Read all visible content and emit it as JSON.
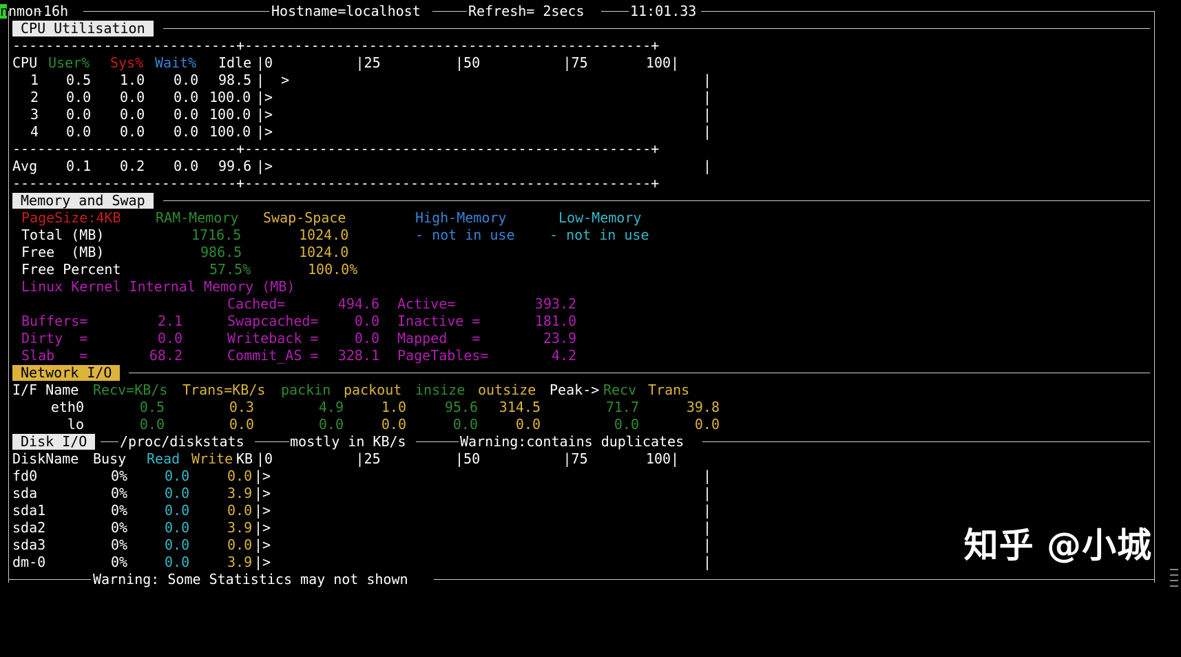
{
  "titlebar": {
    "app": "nmon",
    "version": "16h",
    "hostname": "Hostname=localhost",
    "refresh": "Refresh= 2secs",
    "time": "11:01.33",
    "cursor_char": "n"
  },
  "cpu": {
    "section_title": "CPU Utilisation",
    "separator": "---------------------------+-------------------------------------------------+",
    "columns": {
      "cpu": "CPU",
      "user": "User%",
      "sys": "Sys%",
      "wait": "Wait%",
      "idle": "Idle"
    },
    "scale": "|0          |25         |50          |75       100|",
    "rows": [
      {
        "id": "1",
        "user": "0.5",
        "sys": "1.0",
        "wait": "0.0",
        "idle": "98.5",
        "bar": "|  >"
      },
      {
        "id": "2",
        "user": "0.0",
        "sys": "0.0",
        "wait": "0.0",
        "idle": "100.0",
        "bar": "|>"
      },
      {
        "id": "3",
        "user": "0.0",
        "sys": "0.0",
        "wait": "0.0",
        "idle": "100.0",
        "bar": "|>"
      },
      {
        "id": "4",
        "user": "0.0",
        "sys": "0.0",
        "wait": "0.0",
        "idle": "100.0",
        "bar": "|>"
      }
    ],
    "avg": {
      "id": "Avg",
      "user": "0.1",
      "sys": "0.2",
      "wait": "0.0",
      "idle": "99.6",
      "bar": "|>"
    }
  },
  "memory": {
    "section_title": "Memory and Swap",
    "header": {
      "pagesize": "PageSize:4KB",
      "ram": "RAM-Memory",
      "swap": "Swap-Space",
      "high": "High-Memory",
      "low": "Low-Memory"
    },
    "total": {
      "label": "Total (MB)",
      "ram": "1716.5",
      "swap": "1024.0",
      "high": "- not in use",
      "low": "- not in use"
    },
    "free": {
      "label": "Free  (MB)",
      "ram": "986.5",
      "swap": "1024.0"
    },
    "percent": {
      "label": "Free Percent",
      "ram": "57.5%",
      "swap": "100.0%"
    },
    "kernel_title": "Linux Kernel Internal Memory (MB)",
    "kernel_rows": [
      [
        "",
        "",
        "Cached=",
        "494.6",
        "Active=",
        "393.2"
      ],
      [
        "Buffers=",
        "2.1",
        "Swapcached=",
        "0.0",
        "Inactive =",
        "181.0"
      ],
      [
        "Dirty  =",
        "0.0",
        "Writeback =",
        "0.0",
        "Mapped   =",
        "23.9"
      ],
      [
        "Slab   =",
        "68.2",
        "Commit_AS =",
        "328.1",
        "PageTables=",
        "4.2"
      ]
    ]
  },
  "network": {
    "section_title": "Network I/O",
    "columns": {
      "ifname": "I/F Name",
      "recv": "Recv=KB/s",
      "trans": "Trans=KB/s",
      "packin": "packin",
      "packout": "packout",
      "insize": "insize",
      "outsize": "outsize",
      "peak": "Peak->",
      "peak_recv": "Recv",
      "peak_trans": "Trans"
    },
    "rows": [
      {
        "name": "eth0",
        "recv": "0.5",
        "trans": "0.3",
        "packin": "4.9",
        "packout": "1.0",
        "insize": "95.6",
        "outsize": "314.5",
        "peak_recv": "71.7",
        "peak_trans": "39.8"
      },
      {
        "name": "lo",
        "recv": "0.0",
        "trans": "0.0",
        "packin": "0.0",
        "packout": "0.0",
        "insize": "0.0",
        "outsize": "0.0",
        "peak_recv": "0.0",
        "peak_trans": "0.0"
      }
    ]
  },
  "disk": {
    "section_title": "Disk I/O",
    "source": "/proc/diskstats",
    "units": "mostly in KB/s",
    "warning": "Warning:contains duplicates",
    "columns": {
      "name": "DiskName",
      "busy": "Busy",
      "read": "Read",
      "write": "Write",
      "kb": "KB"
    },
    "scale": "|0          |25         |50          |75       100|",
    "rows": [
      {
        "name": "fd0",
        "busy": "0%",
        "read": "0.0",
        "write": "0.0",
        "bar": "|>"
      },
      {
        "name": "sda",
        "busy": "0%",
        "read": "0.0",
        "write": "3.9",
        "bar": "|>"
      },
      {
        "name": "sda1",
        "busy": "0%",
        "read": "0.0",
        "write": "0.0",
        "bar": "|>"
      },
      {
        "name": "sda2",
        "busy": "0%",
        "read": "0.0",
        "write": "3.9",
        "bar": "|>"
      },
      {
        "name": "sda3",
        "busy": "0%",
        "read": "0.0",
        "write": "0.0",
        "bar": "|>"
      },
      {
        "name": "dm-0",
        "busy": "0%",
        "read": "0.0",
        "write": "3.9",
        "bar": "|>"
      }
    ],
    "bar_end": "|"
  },
  "footer": {
    "warning": "Warning: Some Statistics may not shown"
  },
  "watermark": {
    "text": "知乎 @小城"
  },
  "colors": {
    "user": "#2e8b30",
    "sys": "#c81e1e",
    "wait": "#3b82d6",
    "cyan": "#35b8c8",
    "yellow": "#dcb43c",
    "magenta": "#b21fb2",
    "cursor": "#2ed22e"
  }
}
